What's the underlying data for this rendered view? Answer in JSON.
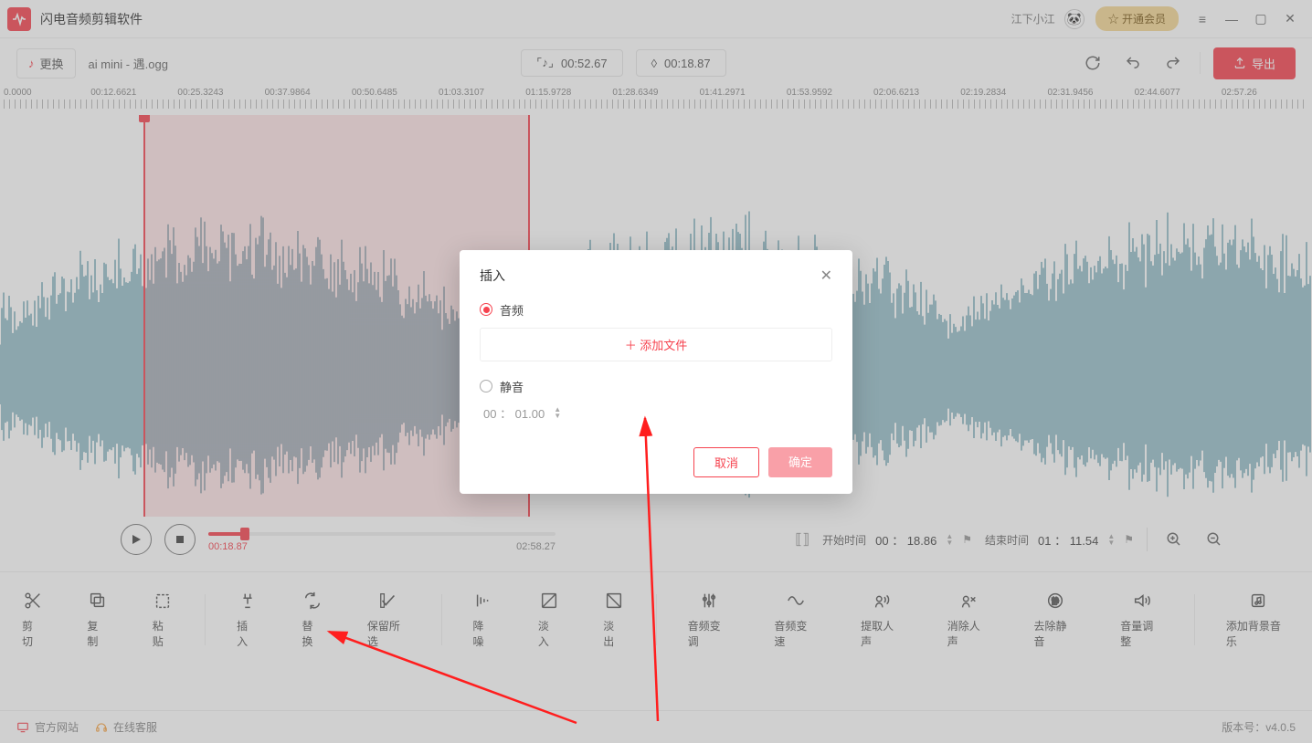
{
  "titlebar": {
    "app_name": "闪电音频剪辑软件",
    "username": "江下小江",
    "vip_label": "☆ 开通会员"
  },
  "topbar": {
    "swap_label": "更换",
    "file_name": "ai mini - 遇.ogg",
    "selection_duration": "00:52.67",
    "playhead_time": "00:18.87",
    "export_label": "导出"
  },
  "ruler": [
    "0.0000",
    "00:12.6621",
    "00:25.3243",
    "00:37.9864",
    "00:50.6485",
    "01:03.3107",
    "01:15.9728",
    "01:28.6349",
    "01:41.2971",
    "01:53.9592",
    "02:06.6213",
    "02:19.2834",
    "02:31.9456",
    "02:44.6077",
    "02:57.26"
  ],
  "playbar": {
    "current_time": "00:18.87",
    "total_time": "02:58.27",
    "progress_pct": 10.6,
    "start_label": "开始时间",
    "start_value": "00 ： 18.86",
    "end_label": "结束时间",
    "end_value": "01 ： 11.54"
  },
  "tools": [
    {
      "id": "cut",
      "label": "剪切"
    },
    {
      "id": "copy",
      "label": "复制"
    },
    {
      "id": "paste",
      "label": "粘贴"
    },
    {
      "id": "sep"
    },
    {
      "id": "insert",
      "label": "插入"
    },
    {
      "id": "replace",
      "label": "替换"
    },
    {
      "id": "keep",
      "label": "保留所选"
    },
    {
      "id": "sep"
    },
    {
      "id": "denoise",
      "label": "降噪"
    },
    {
      "id": "fadein",
      "label": "淡入"
    },
    {
      "id": "fadeout",
      "label": "淡出"
    },
    {
      "id": "sep"
    },
    {
      "id": "pitch",
      "label": "音频变调"
    },
    {
      "id": "speed",
      "label": "音频变速"
    },
    {
      "id": "vocal",
      "label": "提取人声"
    },
    {
      "id": "removevocal",
      "label": "消除人声"
    },
    {
      "id": "removesilence",
      "label": "去除静音"
    },
    {
      "id": "volume",
      "label": "音量调整"
    },
    {
      "id": "sep"
    },
    {
      "id": "bgm",
      "label": "添加背景音乐"
    }
  ],
  "footer": {
    "site": "官方网站",
    "support": "在线客服",
    "version_label": "版本号：",
    "version": "v4.0.5"
  },
  "modal": {
    "title": "插入",
    "option_audio": "音频",
    "add_file": "＋  添加文件",
    "option_silence": "静音",
    "silence_time": "00 ： 01.00",
    "cancel": "取消",
    "ok": "确定"
  },
  "waveform": {
    "selection_left_pct": 10.9,
    "selection_width_pct": 29.5,
    "playhead_pct": 10.9
  }
}
